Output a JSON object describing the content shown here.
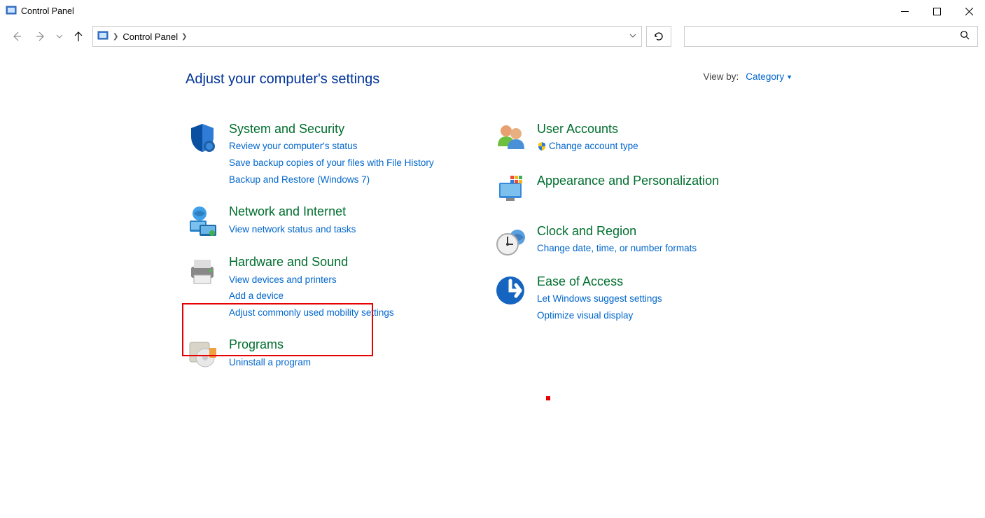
{
  "window": {
    "title": "Control Panel"
  },
  "breadcrumb": {
    "root": "Control Panel"
  },
  "heading": "Adjust your computer's settings",
  "viewby": {
    "label": "View by:",
    "value": "Category"
  },
  "categories": {
    "left": [
      {
        "title": "System and Security",
        "links": [
          "Review your computer's status",
          "Save backup copies of your files with File History",
          "Backup and Restore (Windows 7)"
        ]
      },
      {
        "title": "Network and Internet",
        "links": [
          "View network status and tasks"
        ]
      },
      {
        "title": "Hardware and Sound",
        "links": [
          "View devices and printers",
          "Add a device",
          "Adjust commonly used mobility settings"
        ]
      },
      {
        "title": "Programs",
        "links": [
          "Uninstall a program"
        ]
      }
    ],
    "right": [
      {
        "title": "User Accounts",
        "links": [
          "Change account type"
        ],
        "shield": true
      },
      {
        "title": "Appearance and Personalization",
        "links": []
      },
      {
        "title": "Clock and Region",
        "links": [
          "Change date, time, or number formats"
        ]
      },
      {
        "title": "Ease of Access",
        "links": [
          "Let Windows suggest settings",
          "Optimize visual display"
        ]
      }
    ]
  }
}
